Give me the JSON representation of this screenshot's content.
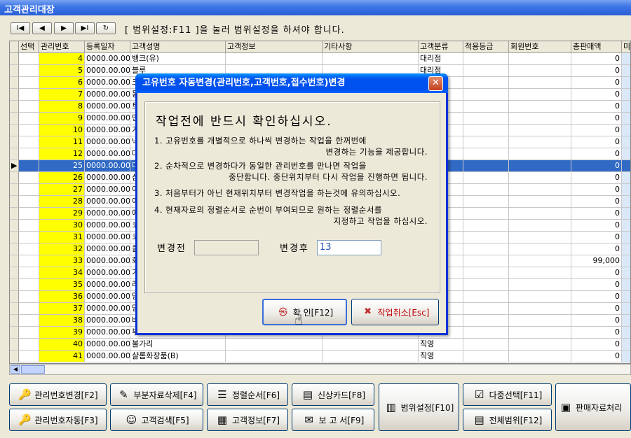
{
  "window": {
    "title": "고객관리대장"
  },
  "nav": {
    "first": "I◀",
    "prev": "◀",
    "next": "▶",
    "last": "▶I",
    "refresh": "↻",
    "hint": "[ 범위설정:F11 ]을 눌러 범위설정을 하셔야 합니다."
  },
  "grid": {
    "columns": [
      "선택",
      "관리번호",
      "등록일자",
      "고객성명",
      "고객정보",
      "기타사항",
      "고객분류",
      "적용등급",
      "회원번호",
      "총판매액",
      "미"
    ],
    "rows": [
      {
        "mgmt": "4",
        "date": "0000.00.00",
        "name": "뱅크(유)",
        "class": "대리점",
        "total": "0"
      },
      {
        "mgmt": "5",
        "date": "0000.00.00",
        "name": "블루",
        "class": "대리점",
        "total": "0"
      },
      {
        "mgmt": "6",
        "date": "0000.00.00",
        "name": "크",
        "class": "",
        "total": "0"
      },
      {
        "mgmt": "7",
        "date": "0000.00.00",
        "name": "동",
        "class": "",
        "total": "0"
      },
      {
        "mgmt": "8",
        "date": "0000.00.00",
        "name": "트",
        "class": "",
        "total": "0"
      },
      {
        "mgmt": "9",
        "date": "0000.00.00",
        "name": "면",
        "class": "",
        "total": "0"
      },
      {
        "mgmt": "10",
        "date": "0000.00.00",
        "name": "거",
        "class": "",
        "total": "0"
      },
      {
        "mgmt": "11",
        "date": "0000.00.00",
        "name": "낙",
        "class": "",
        "total": "0"
      },
      {
        "mgmt": "12",
        "date": "0000.00.00",
        "name": "다",
        "class": "",
        "total": "0"
      },
      {
        "mgmt": "25",
        "date": "0000.00.00",
        "name": "다",
        "class": "",
        "total": "0",
        "current": true
      },
      {
        "mgmt": "26",
        "date": "0000.00.00",
        "name": "삼",
        "class": "",
        "total": "0"
      },
      {
        "mgmt": "27",
        "date": "0000.00.00",
        "name": "아",
        "class": "",
        "total": "0"
      },
      {
        "mgmt": "28",
        "date": "0000.00.00",
        "name": "아",
        "class": "",
        "total": "0"
      },
      {
        "mgmt": "29",
        "date": "0000.00.00",
        "name": "에",
        "class": "",
        "total": "0"
      },
      {
        "mgmt": "30",
        "date": "0000.00.00",
        "name": "코",
        "class": "",
        "total": "0"
      },
      {
        "mgmt": "31",
        "date": "0000.00.00",
        "name": "코",
        "class": "",
        "total": "0"
      },
      {
        "mgmt": "32",
        "date": "0000.00.00",
        "name": "클",
        "class": "",
        "total": "0"
      },
      {
        "mgmt": "33",
        "date": "0000.00.00",
        "name": "화",
        "class": "",
        "total": "99,000"
      },
      {
        "mgmt": "34",
        "date": "0000.00.00",
        "name": "기",
        "class": "",
        "total": "0"
      },
      {
        "mgmt": "35",
        "date": "0000.00.00",
        "name": "라",
        "class": "",
        "total": "0"
      },
      {
        "mgmt": "36",
        "date": "0000.00.00",
        "name": "덤",
        "class": "",
        "total": "0"
      },
      {
        "mgmt": "37",
        "date": "0000.00.00",
        "name": "덤",
        "class": "",
        "total": "0"
      },
      {
        "mgmt": "38",
        "date": "0000.00.00",
        "name": "바",
        "class": "",
        "total": "0"
      },
      {
        "mgmt": "39",
        "date": "0000.00.00",
        "name": "부",
        "class": "",
        "total": "0"
      },
      {
        "mgmt": "40",
        "date": "0000.00.00",
        "name": "불가리",
        "class": "직영",
        "total": "0"
      },
      {
        "mgmt": "41",
        "date": "0000.00.00",
        "name": "샬롬화장품(B)",
        "class": "직영",
        "total": "0"
      }
    ]
  },
  "toolbar": {
    "mgmt_change": "관리번호변경[F2]",
    "partial_delete": "부분자료삭제[F4]",
    "sort_order": "정렬순서[F6]",
    "credit_card": "신상카드[F8]",
    "mgmt_auto": "관리번호자동[F3]",
    "customer_search": "고객검색[F5]",
    "customer_info": "고객정보[F7]",
    "report": "보 고 서[F9]",
    "range_setting": "범위설정[F10]",
    "multi_select": "다중선택[F11]",
    "all_range": "전체범위[F12]",
    "sales_process": "판매자료처리"
  },
  "dialog": {
    "title": "고유번호 자동변경(관리번호,고객번호,접수번호)변경",
    "heading": "작업전에 반드시 확인하십시오.",
    "note1a": "1. 고유번호를 개별적으로 하나씩 변경하는 작업을 한꺼번에",
    "note1b": "변경하는 기능을 제공합니다.",
    "note2a": "2. 순차적으로 변경하다가 동일한 관리번호를 만나면 작업을",
    "note2b": "중단합니다. 중단위치부터 다시 작업을 진행하면 됩니다.",
    "note3": "3. 처음부터가 아닌 현재위치부터 변경작업을 하는것에 유의하십시오.",
    "note4a": "4. 현재자료의 정렬순서로 순번이 부여되므로 원하는 정렬순서를",
    "note4b": "지정하고 작업을 하십시오.",
    "before_label": "변경전",
    "before_value": "",
    "after_label": "변경후",
    "after_value": "13",
    "ok_label": "확 인[F12]",
    "cancel_label": "작업취소[Esc]"
  },
  "colors": {
    "highlight": "#ffff00",
    "selection": "#316ac5",
    "title_bar": "#0053ee"
  }
}
